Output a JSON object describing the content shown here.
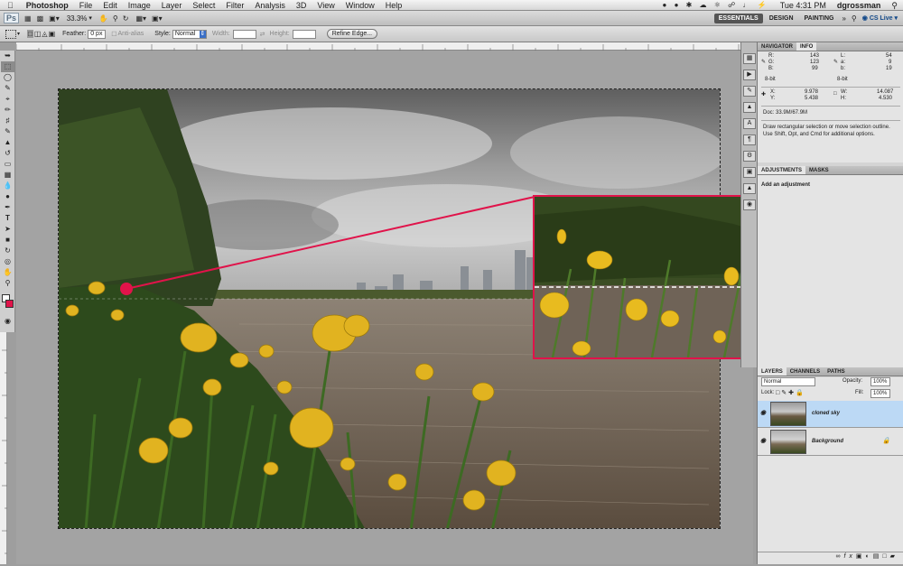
{
  "menubar": {
    "app": "Photoshop",
    "items": [
      "File",
      "Edit",
      "Image",
      "Layer",
      "Select",
      "Filter",
      "Analysis",
      "3D",
      "View",
      "Window",
      "Help"
    ],
    "clock": "Tue 4:31 PM",
    "user": "dgrossman"
  },
  "appbar": {
    "zoom": "33.3%",
    "workspaces": [
      "ESSENTIALS",
      "DESIGN",
      "PAINTING"
    ],
    "active_workspace": "ESSENTIALS",
    "cs_live": "CS Live"
  },
  "options": {
    "feather_label": "Feather:",
    "feather_value": "0 px",
    "anti_alias": "Anti-alias",
    "style_label": "Style:",
    "style_value": "Normal",
    "width_label": "Width:",
    "height_label": "Height:",
    "refine_edge": "Refine Edge..."
  },
  "info_panel": {
    "tabs": [
      "NAVIGATOR",
      "INFO"
    ],
    "active_tab": "INFO",
    "rgb": [
      {
        "k": "R:",
        "v": "143"
      },
      {
        "k": "G:",
        "v": "123"
      },
      {
        "k": "B:",
        "v": "99"
      }
    ],
    "lab": [
      {
        "k": "L:",
        "v": "54"
      },
      {
        "k": "a:",
        "v": "9"
      },
      {
        "k": "b:",
        "v": "19"
      }
    ],
    "bit_left": "8-bit",
    "bit_right": "8-bit",
    "x": "9.978",
    "y": "5.438",
    "w": "14.087",
    "h": "4.530",
    "doc": "Doc: 33.9M/67.9M",
    "hint": "Draw rectangular selection or move selection outline. Use Shift, Opt, and Cmd for additional options."
  },
  "adjustments_panel": {
    "tabs": [
      "ADJUSTMENTS",
      "MASKS"
    ],
    "title": "Add an adjustment"
  },
  "layers_panel": {
    "tabs": [
      "LAYERS",
      "CHANNELS",
      "PATHS"
    ],
    "blend_mode": "Normal",
    "opacity_label": "Opacity:",
    "opacity": "100%",
    "lock_label": "Lock:",
    "fill_label": "Fill:",
    "fill": "100%",
    "layers": [
      {
        "name": "cloned sky",
        "selected": true
      },
      {
        "name": "Background",
        "selected": false
      }
    ]
  },
  "colors": {
    "highlight": "#e0134a",
    "selected_layer": "#bcd9f5",
    "active_workspace_bg": "#555555"
  }
}
